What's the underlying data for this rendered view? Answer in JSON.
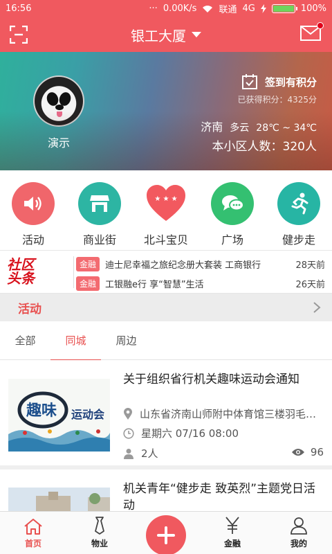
{
  "status_bar": {
    "time": "16:56",
    "speed": "0.00K/s",
    "carrier": "联通",
    "network": "4G",
    "battery": "100%",
    "battery_level": 1.0,
    "dots": "···"
  },
  "header": {
    "title": "银工大厦"
  },
  "profile": {
    "name": "演示",
    "checkin_label": "签到有积分",
    "points_text": "已获得积分：4325分",
    "city": "济南",
    "weather": "多云",
    "temperature": "28℃ ~ 34℃",
    "residents_text": "本小区人数：320人"
  },
  "features": [
    {
      "label": "活动",
      "icon": "speaker-icon",
      "color": "#f0666b"
    },
    {
      "label": "商业街",
      "icon": "shop-icon",
      "color": "#2db5a3"
    },
    {
      "label": "北斗宝贝",
      "icon": "heart-stars-icon",
      "color": "#f2595f"
    },
    {
      "label": "广场",
      "icon": "chat-bubbles-icon",
      "color": "#34c071"
    },
    {
      "label": "健步走",
      "icon": "runner-icon",
      "color": "#27b5a4"
    }
  ],
  "headlines": {
    "logo_line1": "社区",
    "logo_line2": "头条",
    "items": [
      {
        "tag": "金融",
        "text": "迪士尼幸福之旅纪念册大套装  工商银行",
        "time": "28天前"
      },
      {
        "tag": "金融",
        "text": "工银融e行   享“智慧”生活",
        "time": "26天前"
      }
    ]
  },
  "section": {
    "title": "活动"
  },
  "tabs": [
    {
      "label": "全部"
    },
    {
      "label": "同城"
    },
    {
      "label": "周边"
    }
  ],
  "events": [
    {
      "title": "关于组织省行机关趣味运动会通知",
      "location": "山东省济南山师附中体育馆三楼羽毛球馆",
      "time": "星期六 07/16 08:00",
      "people": "2人",
      "views": "96",
      "thumb_text_a": "趣味",
      "thumb_text_b": "运动会"
    },
    {
      "title": "机关青年“健步走 致英烈”主题党日活动"
    }
  ],
  "bottom_nav": [
    {
      "label": "首页"
    },
    {
      "label": "物业"
    },
    {
      "label": "金融"
    },
    {
      "label": "我的"
    }
  ],
  "colors": {
    "brand": "#f0595f",
    "accent": "#e8504f"
  }
}
